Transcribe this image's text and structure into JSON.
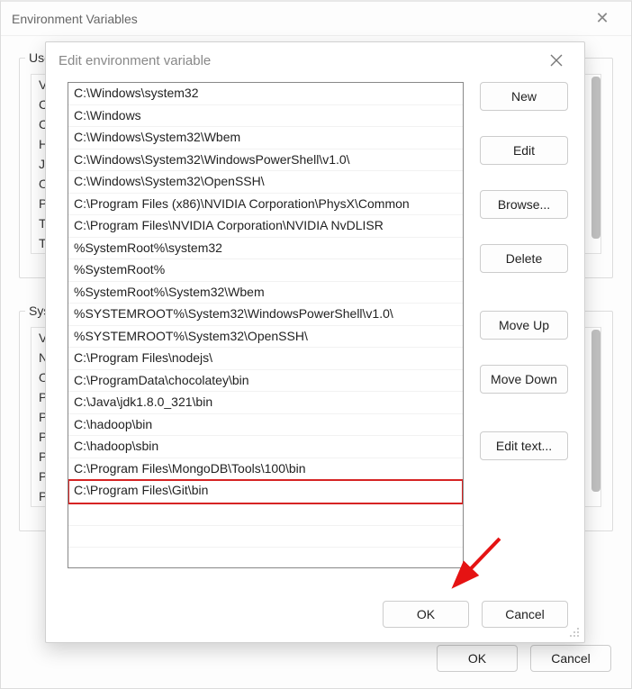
{
  "bg_dialog": {
    "title": "Environment Variables",
    "user_group_label": "User",
    "system_group_label": "Syste",
    "user_vars": [
      "Va",
      "Ch",
      "Ch",
      "HA",
      "JA",
      "On",
      "Pa",
      "TE",
      "TM"
    ],
    "system_vars": [
      "Va",
      "NU",
      "OS",
      "Pa",
      "PA",
      "PR",
      "PR",
      "PR",
      "PR"
    ],
    "ok_label": "OK",
    "cancel_label": "Cancel"
  },
  "edit_dialog": {
    "title": "Edit environment variable",
    "paths": [
      "C:\\Windows\\system32",
      "C:\\Windows",
      "C:\\Windows\\System32\\Wbem",
      "C:\\Windows\\System32\\WindowsPowerShell\\v1.0\\",
      "C:\\Windows\\System32\\OpenSSH\\",
      "C:\\Program Files (x86)\\NVIDIA Corporation\\PhysX\\Common",
      "C:\\Program Files\\NVIDIA Corporation\\NVIDIA NvDLISR",
      "%SystemRoot%\\system32",
      "%SystemRoot%",
      "%SystemRoot%\\System32\\Wbem",
      "%SYSTEMROOT%\\System32\\WindowsPowerShell\\v1.0\\",
      "%SYSTEMROOT%\\System32\\OpenSSH\\",
      "C:\\Program Files\\nodejs\\",
      "C:\\ProgramData\\chocolatey\\bin",
      "C:\\Java\\jdk1.8.0_321\\bin",
      "C:\\hadoop\\bin",
      "C:\\hadoop\\sbin",
      "C:\\Program Files\\MongoDB\\Tools\\100\\bin",
      "C:\\Program Files\\Git\\bin"
    ],
    "highlighted_index": 18,
    "buttons": {
      "new": "New",
      "edit": "Edit",
      "browse": "Browse...",
      "delete": "Delete",
      "move_up": "Move Up",
      "move_down": "Move Down",
      "edit_text": "Edit text...",
      "ok": "OK",
      "cancel": "Cancel"
    }
  },
  "colors": {
    "highlight_border": "#d62424",
    "arrow": "#e51313"
  }
}
